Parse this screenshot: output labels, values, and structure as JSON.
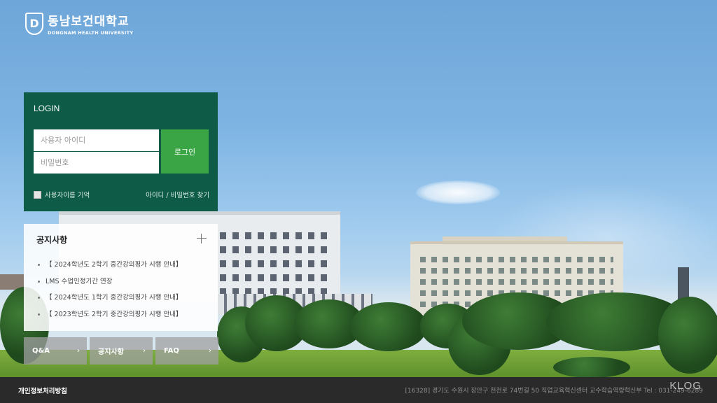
{
  "logo": {
    "name_kr": "동남보건대학교",
    "name_en": "DONGNAM HEALTH UNIVERSITY",
    "emblem": "D"
  },
  "login": {
    "title": "LOGIN",
    "username_placeholder": "사용자 아이디",
    "password_placeholder": "비밀번호",
    "button_label": "로그인",
    "remember_label": "사용자이름 기억",
    "find_link": "아이디 / 비밀번호 찾기"
  },
  "notice": {
    "title": "공지사항",
    "items": [
      "【 2024학년도 2학기 중간강의평가 시행 안내】",
      "LMS 수업인정기간 연장",
      "【 2024학년도 1학기 중간강의평가 시행 안내】",
      "【 2023학년도 2학기 중간강의평가 시행 안내】"
    ]
  },
  "quick_links": [
    "Q&A",
    "공지사항",
    "FAQ"
  ],
  "footer": {
    "privacy": "개인정보처리방침",
    "address": "[16328] 경기도 수원시 장안구 천천로 74번길 50 직업교육혁신센터 교수학습역량혁신부  Tel : 031-249-6289"
  },
  "watermark": "KLOG",
  "colors": {
    "login_panel": "#0e5c47",
    "login_button": "#3aa545",
    "footer": "#2a2a2a"
  }
}
